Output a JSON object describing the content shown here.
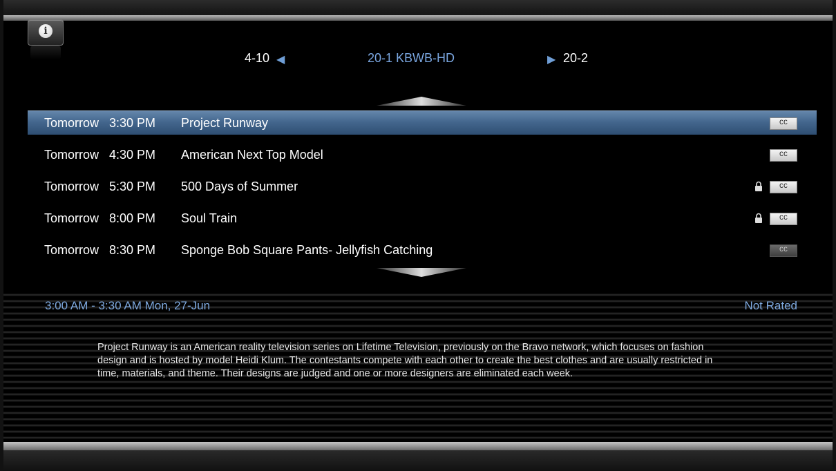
{
  "header": {
    "info_icon": "info-icon",
    "prev_channel": "4-10",
    "current_channel": "20-1 KBWB-HD",
    "next_channel": "20-2"
  },
  "schedule": [
    {
      "day": "Tomorrow",
      "time": "3:30 PM",
      "title": "Project Runway",
      "locked": false,
      "cc": "CC",
      "selected": true
    },
    {
      "day": "Tomorrow",
      "time": "4:30 PM",
      "title": "American Next Top Model",
      "locked": false,
      "cc": "CC",
      "selected": false
    },
    {
      "day": "Tomorrow",
      "time": "5:30 PM",
      "title": "500 Days of Summer",
      "locked": true,
      "cc": "CC",
      "selected": false
    },
    {
      "day": "Tomorrow",
      "time": "8:00 PM",
      "title": "Soul Train",
      "locked": true,
      "cc": "CC",
      "selected": false
    },
    {
      "day": "Tomorrow",
      "time": "8:30 PM",
      "title": "Sponge Bob Square Pants- Jellyfish Catching",
      "locked": false,
      "cc": "CC",
      "selected": false
    }
  ],
  "details": {
    "time_range": "3:00 AM - 3:30 AM Mon, 27-Jun",
    "rating": "Not Rated",
    "description": "Project Runway is an American reality television series on Lifetime Television, previously on the Bravo network, which focuses on fashion design and is hosted by model Heidi Klum. The contestants compete with each other to create the best clothes and are usually restricted in time, materials, and theme. Their designs are judged and one or more designers are eliminated each week."
  },
  "colors": {
    "accent_blue": "#7aa6e0",
    "selected_row": "#44678e"
  }
}
